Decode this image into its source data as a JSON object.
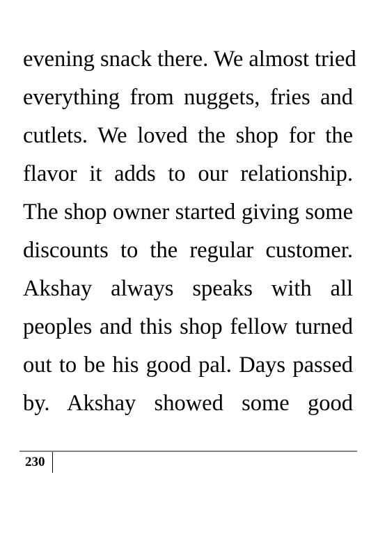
{
  "body": {
    "lines": [
      "evening snack there. We almost tried",
      "everything from nuggets, fries and",
      "cutlets. We loved the shop for the",
      "flavor it adds to our relationship.",
      "The shop owner started giving some",
      "discounts to the regular customer.",
      "Akshay always speaks with all",
      "peoples and this shop fellow turned",
      "out to be his good pal. Days passed",
      "by. Akshay showed some good"
    ]
  },
  "footer": {
    "page_number": "230"
  }
}
